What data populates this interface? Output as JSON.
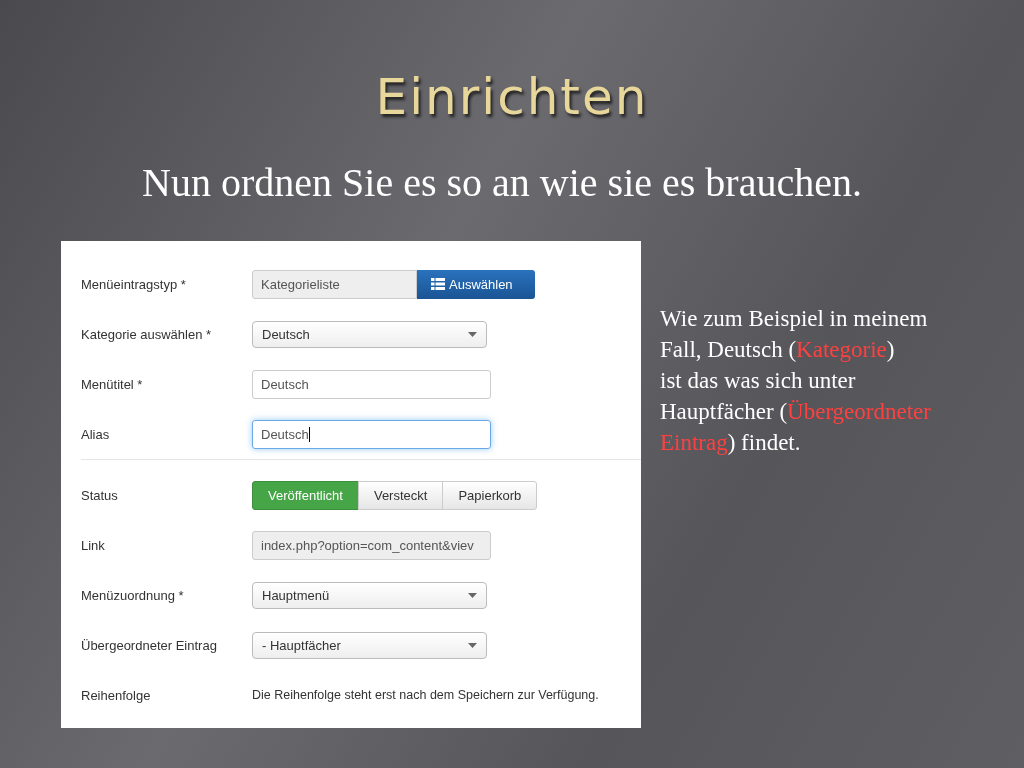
{
  "slide": {
    "title": "Einrichten",
    "subtitle": "Nun ordnen Sie es so an wie sie es brauchen."
  },
  "form": {
    "rows": [
      {
        "kind": "picker",
        "label": "Menüeintragstyp *",
        "value": "Kategorieliste",
        "button": "Auswählen"
      },
      {
        "kind": "select",
        "label": "Kategorie auswählen *",
        "value": "Deutsch"
      },
      {
        "kind": "text",
        "label": "Menütitel *",
        "value": "Deutsch",
        "focused": false
      },
      {
        "kind": "text",
        "label": "Alias",
        "value": "Deutsch",
        "focused": true
      },
      {
        "kind": "divider"
      },
      {
        "kind": "status",
        "label": "Status",
        "options": [
          {
            "label": "Veröffentlicht",
            "selected": true
          },
          {
            "label": "Versteckt",
            "selected": false
          },
          {
            "label": "Papierkorb",
            "selected": false
          }
        ]
      },
      {
        "kind": "readonly",
        "label": "Link",
        "value": "index.php?option=com_content&viev"
      },
      {
        "kind": "select",
        "label": "Menüzuordnung *",
        "value": "Hauptmenü"
      },
      {
        "kind": "select",
        "label": "Übergeordneter Eintrag",
        "value": "- Hauptfächer"
      },
      {
        "kind": "note",
        "label": "Reihenfolge",
        "value": "Die Reihenfolge steht erst nach dem Speichern zur Verfügung."
      }
    ]
  },
  "note": {
    "lines": [
      [
        {
          "text": "Wie zum Beispiel in meinem",
          "highlight": false
        }
      ],
      [
        {
          "text": "Fall, Deutsch (",
          "highlight": false
        },
        {
          "text": "Kategorie",
          "highlight": true
        },
        {
          "text": ")",
          "highlight": false
        }
      ],
      [
        {
          "text": "ist das was sich unter",
          "highlight": false
        }
      ],
      [
        {
          "text": "Hauptfächer (",
          "highlight": false
        },
        {
          "text": "Übergeordneter",
          "highlight": true
        }
      ],
      [
        {
          "text": "Eintrag",
          "highlight": true
        },
        {
          "text": ") findet.",
          "highlight": false
        }
      ]
    ]
  }
}
